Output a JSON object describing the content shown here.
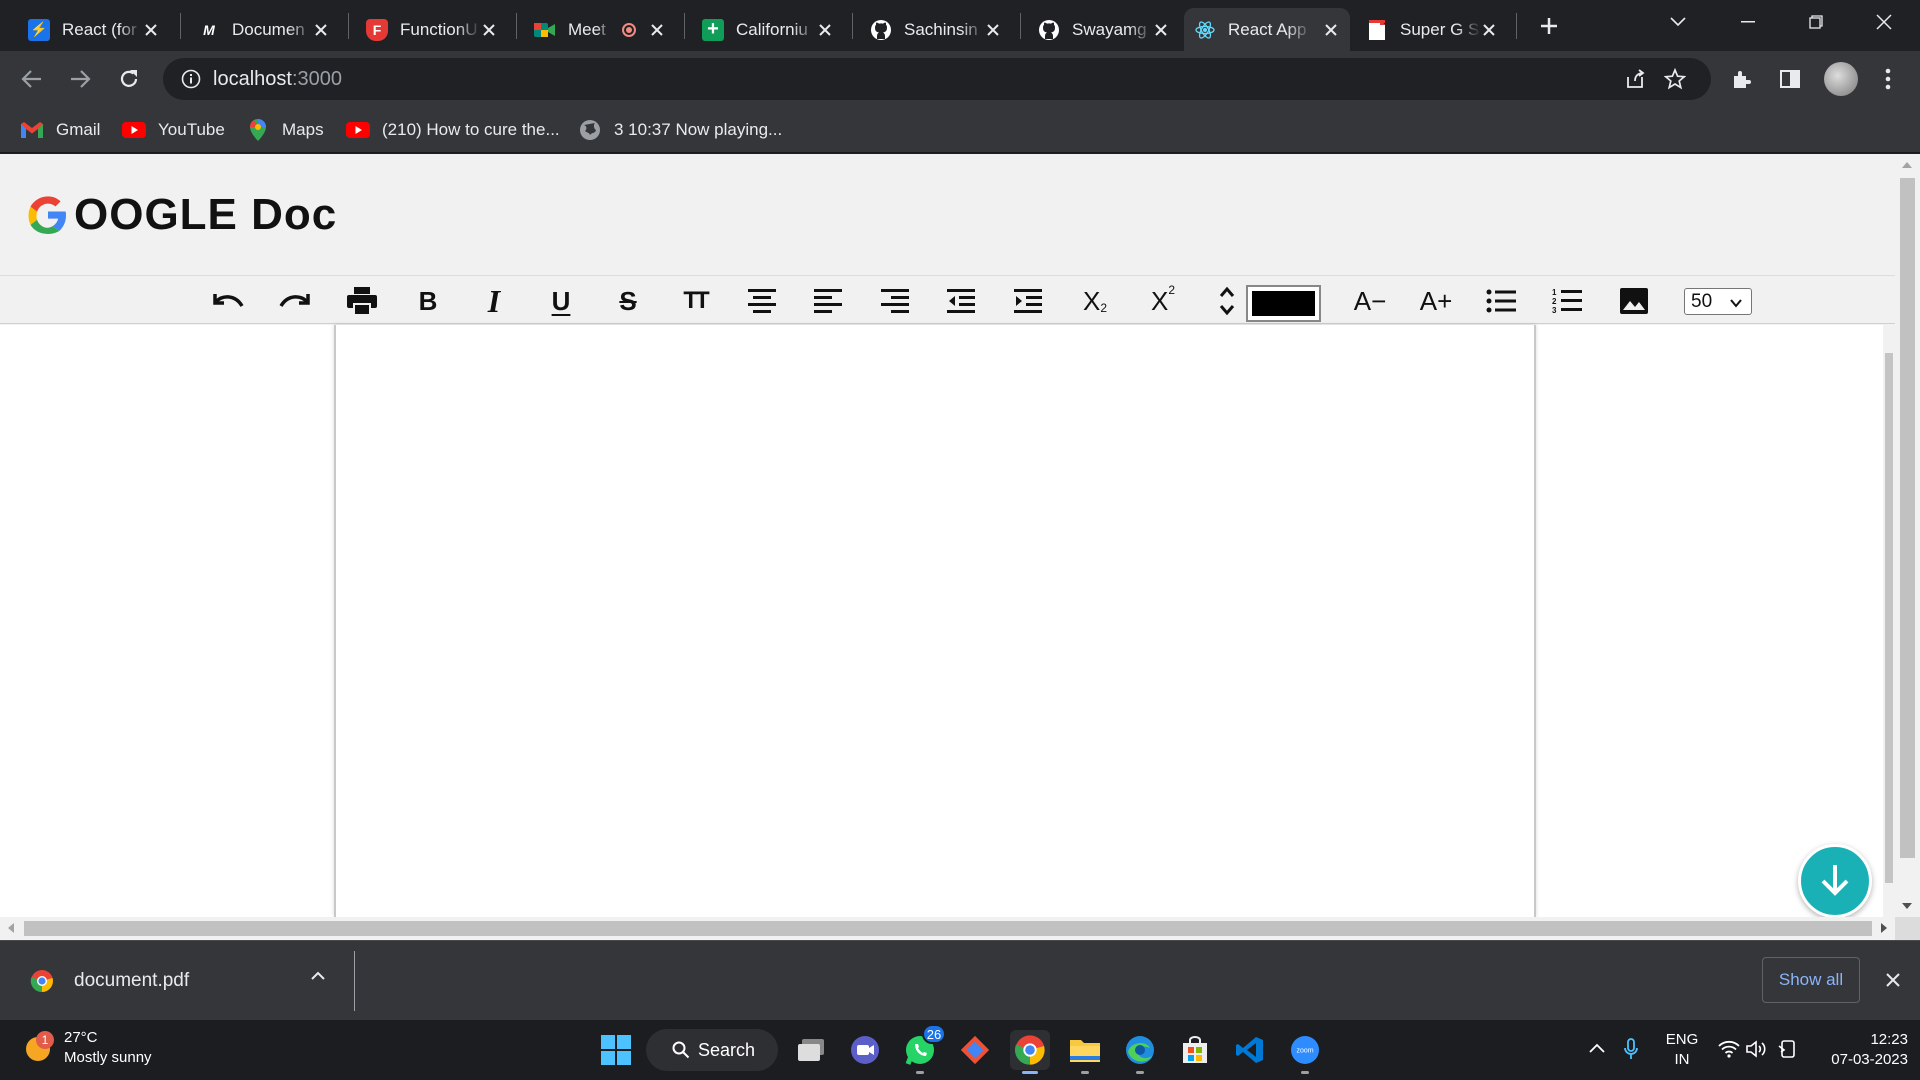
{
  "browser": {
    "tabs": [
      {
        "title": "React (for",
        "favicon": "bolt-icon",
        "color": "#1a73e8",
        "active": false
      },
      {
        "title": "Documen",
        "favicon": "m-logo-icon",
        "color": "#202124",
        "active": false
      },
      {
        "title": "FunctionU",
        "favicon": "shield-icon",
        "color": "#e53935",
        "active": false
      },
      {
        "title": "Meet",
        "favicon": "meet-icon",
        "color": "#00897b",
        "active": false,
        "recording": true
      },
      {
        "title": "Californiu",
        "favicon": "sheets-icon",
        "color": "#0f9d58",
        "active": false
      },
      {
        "title": "Sachinsin",
        "favicon": "github-icon",
        "color": "#ffffff",
        "active": false
      },
      {
        "title": "Swayamg",
        "favicon": "github-icon",
        "color": "#ffffff",
        "active": false
      },
      {
        "title": "React App",
        "favicon": "react-icon",
        "color": "#61dafb",
        "active": true
      },
      {
        "title": "Super G S",
        "favicon": "doc-icon",
        "color": "#ffffff",
        "active": false
      }
    ],
    "url_host": "localhost",
    "url_port": ":3000",
    "bookmarks": [
      {
        "label": "Gmail",
        "icon": "gmail-icon"
      },
      {
        "label": "YouTube",
        "icon": "youtube-icon"
      },
      {
        "label": "Maps",
        "icon": "maps-icon"
      },
      {
        "label": "(210) How to cure the...",
        "icon": "youtube-icon"
      },
      {
        "label": "3 10:37 Now playing...",
        "icon": "globe-icon"
      }
    ]
  },
  "app": {
    "logo_letter": "G",
    "title": "OOGLE Doc",
    "toolbar": {
      "font_size_value": "50",
      "font_color": "#000000",
      "buttons": [
        "undo",
        "redo",
        "print",
        "bold",
        "italic",
        "underline",
        "strikethrough",
        "text-height",
        "align-center",
        "align-left",
        "align-right",
        "outdent",
        "indent",
        "subscript",
        "superscript",
        "line-height",
        "color",
        "decrease-font",
        "increase-font",
        "bulleted-list",
        "numbered-list",
        "insert-image",
        "font-size"
      ],
      "bold_label": "B",
      "italic_label": "I",
      "underline_label": "U",
      "strike_label": "S",
      "text_height_label": "TT",
      "subscript_label": "X",
      "subscript_sub": "2",
      "superscript_label": "X",
      "superscript_sup": "2",
      "decrease_label": "A−",
      "increase_label": "A+"
    },
    "accent": "#1ab1b6"
  },
  "download_shelf": {
    "file_name": "document.pdf",
    "show_all_label": "Show all"
  },
  "taskbar": {
    "weather_temp": "27°C",
    "weather_desc": "Mostly sunny",
    "weather_badge": "1",
    "search_label": "Search",
    "whatsapp_badge": "26",
    "lang_line1": "ENG",
    "lang_line2": "IN",
    "time": "12:23",
    "date": "07-03-2023"
  }
}
